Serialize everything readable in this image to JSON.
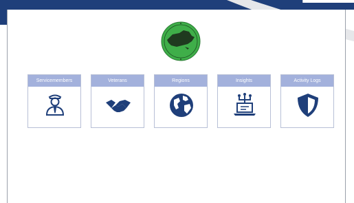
{
  "theme": {
    "header_color": "#1f3f7a",
    "card_header_color": "#a3b1dc",
    "card_border_color": "#b7bfd6",
    "icon_color": "#1f3f7a",
    "logo_green": "#3fae49"
  },
  "logo": {
    "icon": "new-york-state-seal-logo"
  },
  "tiles": [
    {
      "label": "Servicemembers",
      "icon": "servicemember-icon"
    },
    {
      "label": "Veterans",
      "icon": "handshake-icon"
    },
    {
      "label": "Regions",
      "icon": "globe-icon"
    },
    {
      "label": "Insights",
      "icon": "network-laptop-icon"
    },
    {
      "label": "Activity Logs",
      "icon": "shield-icon"
    }
  ]
}
